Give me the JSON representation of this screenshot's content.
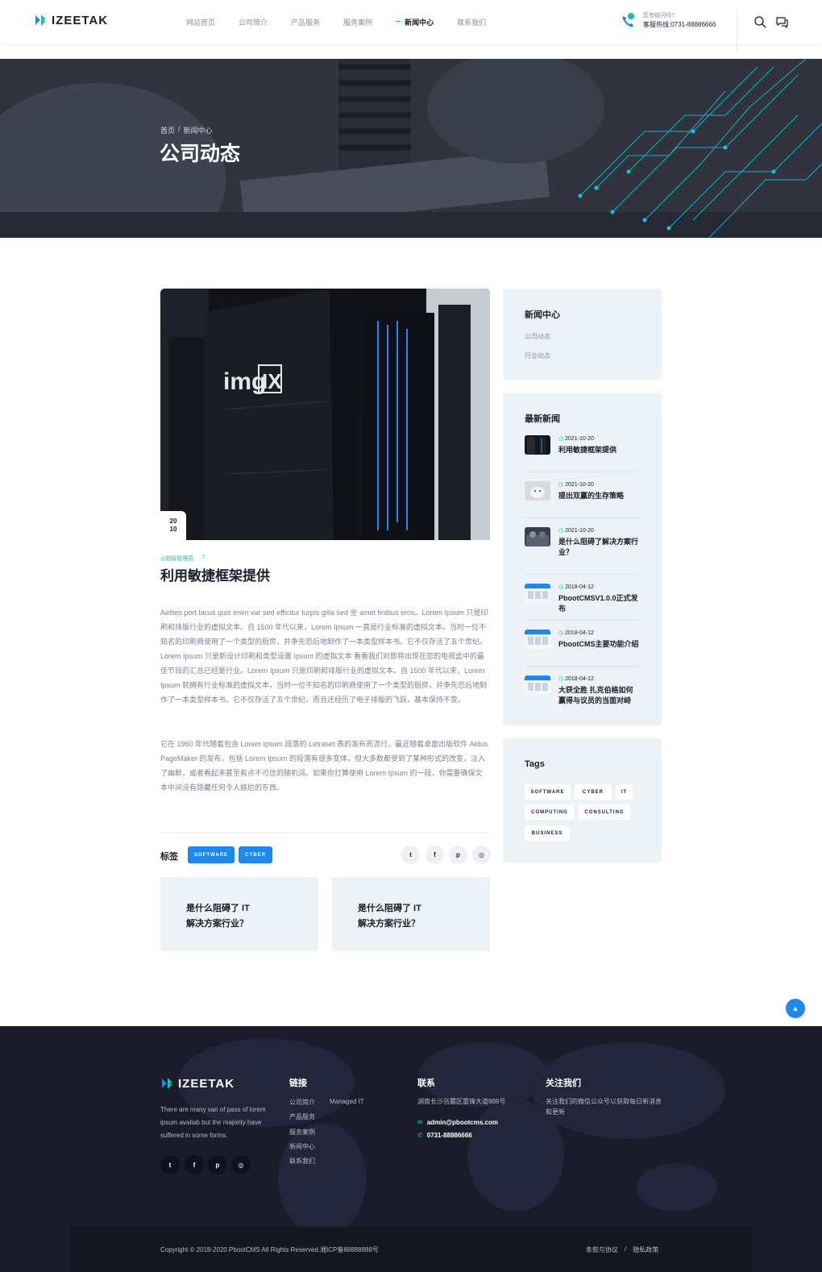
{
  "header": {
    "logo": "IZEETAK",
    "nav": [
      {
        "label": "网站首页"
      },
      {
        "label": "公司简介"
      },
      {
        "label": "产品服务"
      },
      {
        "label": "服务案例"
      },
      {
        "label": "新闻中心",
        "active": true
      },
      {
        "label": "联系我们"
      }
    ],
    "hotline_question": "您有疑问吗?",
    "hotline_number": "客服热线:0731-88886666",
    "icons": [
      "phone-icon",
      "search-icon",
      "chat-icon"
    ]
  },
  "hero": {
    "breadcrumb": [
      "首页",
      "/",
      "新闻中心"
    ],
    "title": "公司动态"
  },
  "article": {
    "date_day": "20",
    "date_month": "10",
    "author": "超级管理员",
    "comments": "7",
    "title": "利用敏捷框架提供",
    "paragraph1": "Aelltes port lacus quis enim var sed efficitur turpis gilla sed 坐 amet finibus eros。Lorem Ipsum 只是印刷和排版行业的虚拟文本。自 1500 年代以来，Lorem Ipsum 一直是行业标准的虚拟文本，当时一位不知名的印刷商使用了一个类型的厨房，并争先恐后地制作了一本类型样本书。它不仅存活了五个世纪。Lorem Ipsum 只是新设计印刷和类型设置 Ipsum 的虚拟文本 看看我们对即将出现在您的电视盒中的最佳节目的汇总已经是行业。Lorem Ipsum 只是印刷和排版行业的虚拟文本。自 1500 年代以来，Lorem Ipsum 就拥有行业标准的虚拟文本，当时一位不知名的印刷商使用了一个类型的厨房，并争先恐后地制作了一本类型样本书。它不仅存活了五个世纪，而且还经历了电子排版的飞跃，基本保持不变。",
    "paragraph2": "它在 1960 年代随着包含 Lorem Ipsum 段落的 Letraset 表的发布而流行，最近随着桌面出版软件 Aldus PageMaker 的发布，包括 Lorem Ipsum 的段落有很多变体，但大多数都受到了某种形式的改变，注入了幽默，或者看起来甚至有点不可信的随机词。如果你打算使用 Lorem Ipsum 的一段，你需要确保文本中间没有隐藏任何令人尴尬的东西。",
    "tags_label": "标签",
    "tags": [
      "SOFTWARE",
      "CYBER"
    ],
    "share": [
      "twitter-icon",
      "facebook-icon",
      "pinterest-icon",
      "instagram-icon"
    ],
    "related": [
      {
        "line1": "是什么阻碍了 IT",
        "line2": "解决方案行业？"
      },
      {
        "line1": "是什么阻碍了 IT",
        "line2": "解决方案行业？"
      }
    ]
  },
  "sidebar": {
    "category_title": "新闻中心",
    "categories": [
      "公司动态",
      "行业动态"
    ],
    "latest_title": "最新新闻",
    "latest": [
      {
        "date": "2021-10-20",
        "title": "利用敏捷框架提供"
      },
      {
        "date": "2021-10-20",
        "title": "提出双赢的生存策略"
      },
      {
        "date": "2021-10-20",
        "title": "是什么阻碍了解决方案行业？"
      },
      {
        "date": "2018-04-12",
        "title": "PbootCMSV1.0.0正式发布"
      },
      {
        "date": "2018-04-12",
        "title": "PbootCMS主要功能介绍"
      },
      {
        "date": "2018-04-12",
        "title": "大获全胜 扎克伯格如何赢得与议员的当面对峙"
      }
    ],
    "tags_title": "Tags",
    "tags": [
      "SOFTWARE",
      "CYBER",
      "IT",
      "COMPUTING",
      "CONSULTING",
      "BUSINESS"
    ]
  },
  "footer": {
    "logo": "IZEETAK",
    "about": "There are many vari of pass of lorem ipsum availab but the majority have suffered in some forms.",
    "social": [
      "twitter-icon",
      "facebook-icon",
      "pinterest-icon",
      "instagram-icon"
    ],
    "links_title": "链接",
    "links": [
      "公司简介",
      "产品服务",
      "服务案例",
      "新闻中心",
      "联系我们"
    ],
    "links_extra": "Managed IT",
    "contact_title": "联系",
    "address": "湖南长沙岳麓区雷锋大道888号",
    "email": "admin@pbootcms.com",
    "phone": "0731-88886666",
    "follow_title": "关注我们",
    "follow_text": "关注我们的微信公众号以获取每日新消息和更新",
    "copyright": "Copyright © 2018-2020 PbootCMS All Rights Reserved.湘ICP备88888888号",
    "bottom_links": [
      "条款与协议",
      "/",
      "隐私政策"
    ]
  },
  "colors": {
    "accent": "#1e88f0",
    "teal": "#12c2a9",
    "dark": "#1b1c2b",
    "panel": "#edf2f6"
  }
}
